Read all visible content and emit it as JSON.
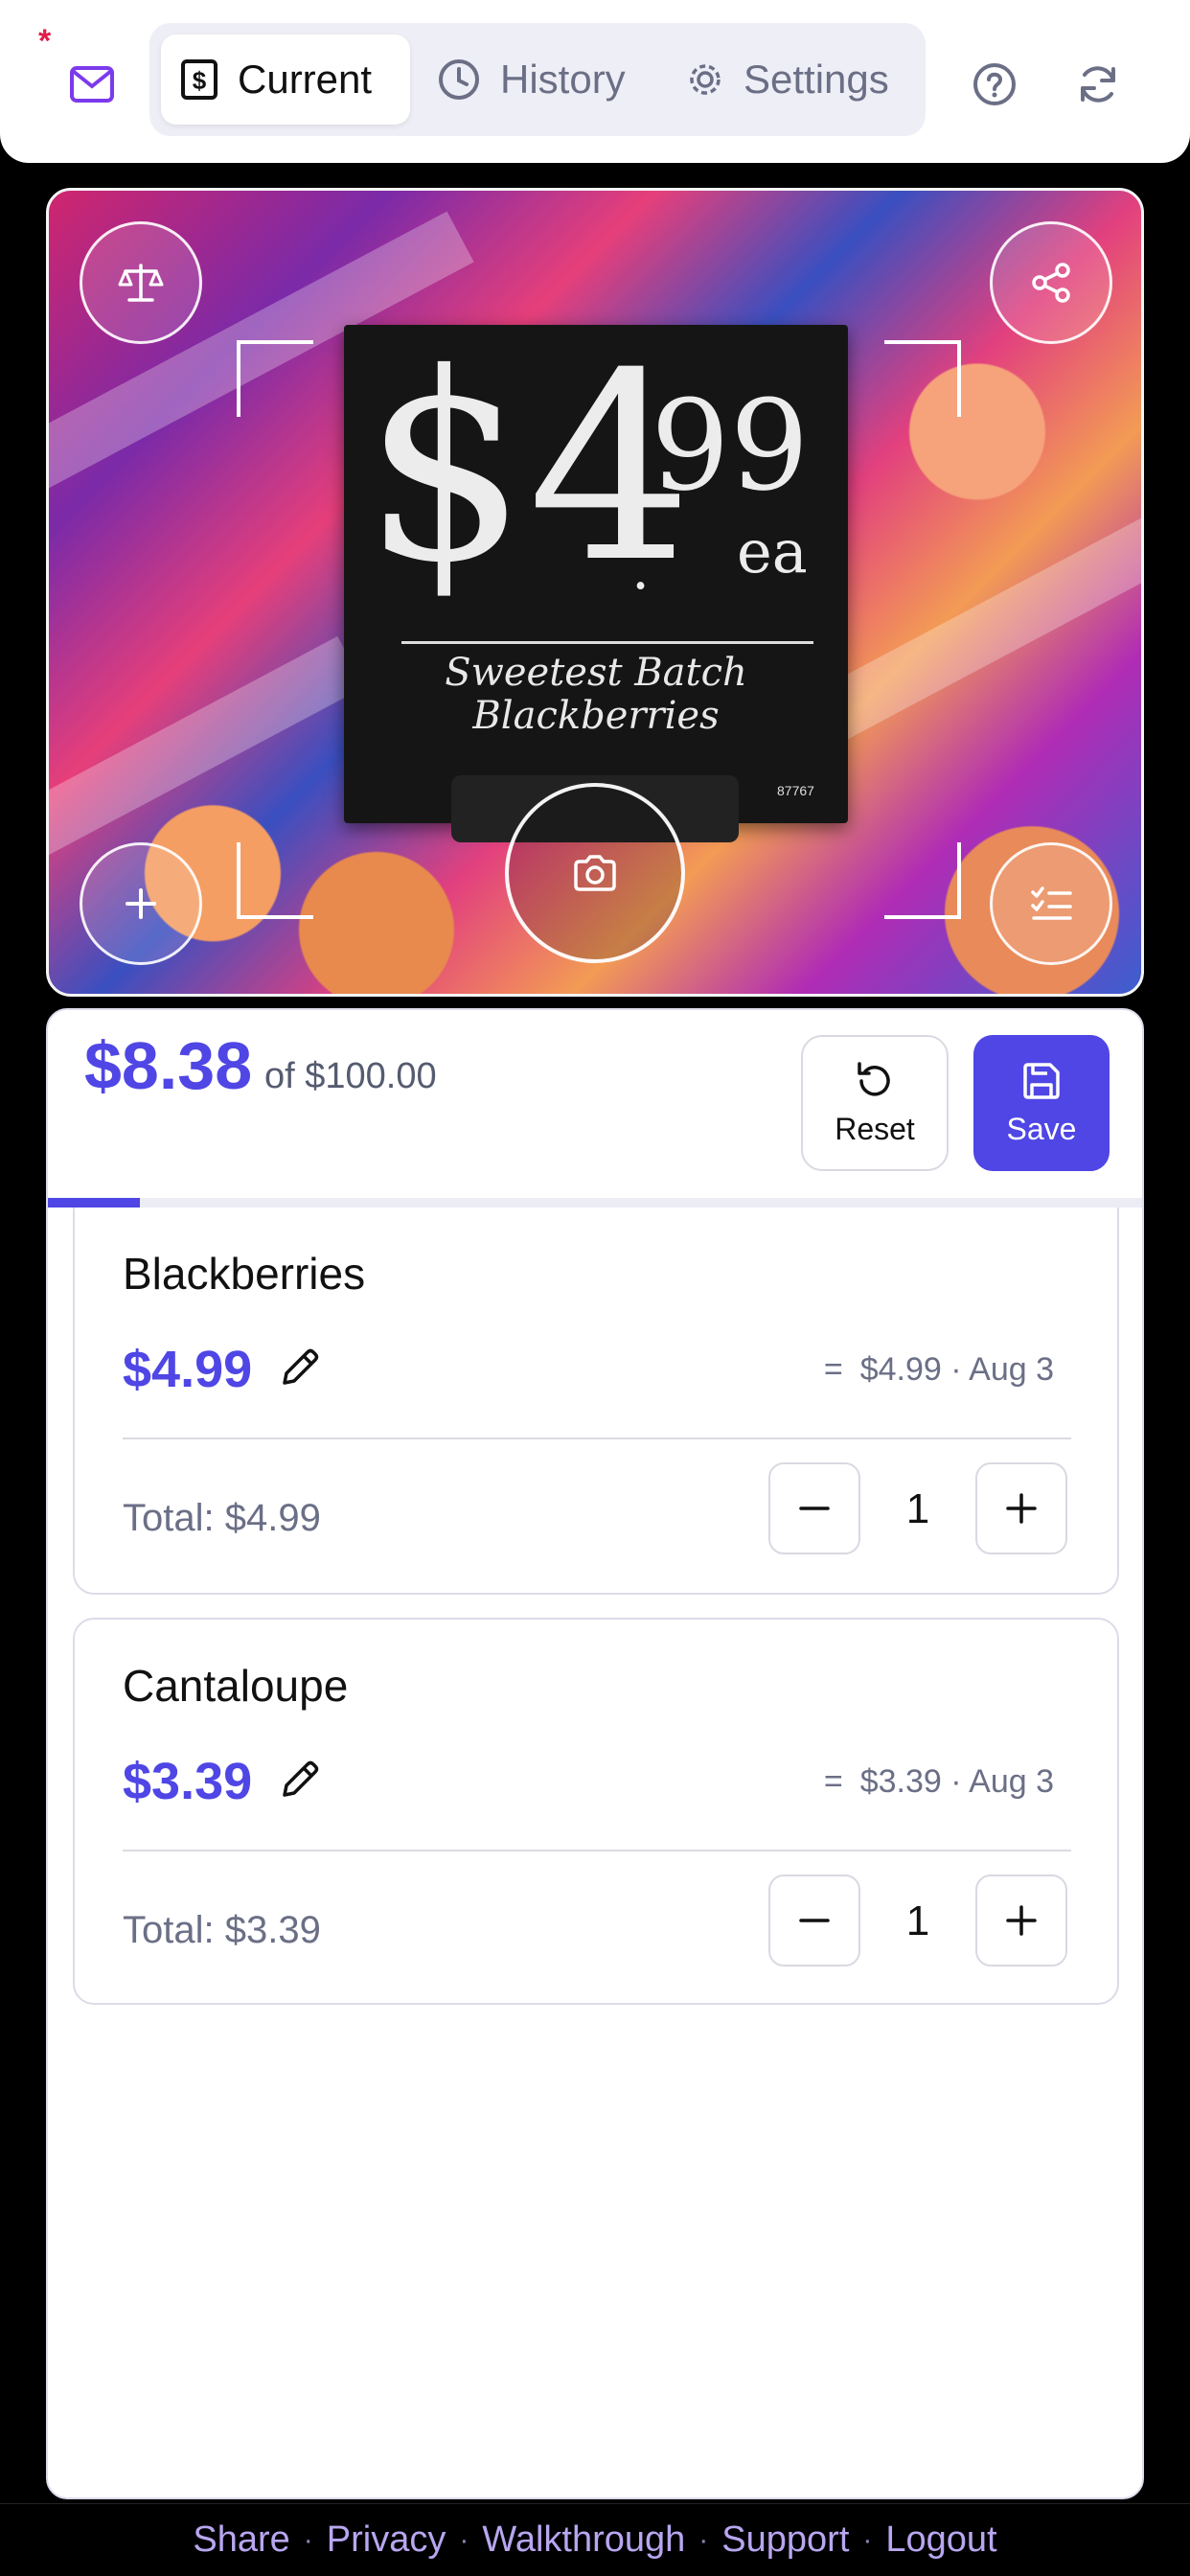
{
  "header": {
    "unread_marker": "*",
    "tabs": [
      {
        "label": "Current",
        "icon": "receipt-dollar-icon",
        "active": true
      },
      {
        "label": "History",
        "icon": "clock-icon",
        "active": false
      },
      {
        "label": "Settings",
        "icon": "gear-icon",
        "active": false
      }
    ]
  },
  "camera": {
    "sign": {
      "price_dollars": "$4",
      "price_cents": "99",
      "unit": "ea",
      "caption_line1": "Sweetest Batch",
      "caption_line2": "Blackberries",
      "code": "87767"
    }
  },
  "summary": {
    "total": "$8.38",
    "budget": "of $100.00",
    "budget_fraction": 0.0838,
    "reset_label": "Reset",
    "save_label": "Save"
  },
  "items": [
    {
      "name": "Blackberries",
      "price": "$4.99",
      "history": "$4.99 · Aug 3",
      "total": "Total: $4.99",
      "qty": "1"
    },
    {
      "name": "Cantaloupe",
      "price": "$3.39",
      "history": "$3.39 · Aug 3",
      "total": "Total: $3.39",
      "qty": "1"
    }
  ],
  "footer": {
    "links": [
      "Share",
      "Privacy",
      "Walkthrough",
      "Support",
      "Logout"
    ],
    "separator": "·"
  },
  "colors": {
    "accent": "#4f46e5",
    "footer_link": "#b8a6f0"
  }
}
